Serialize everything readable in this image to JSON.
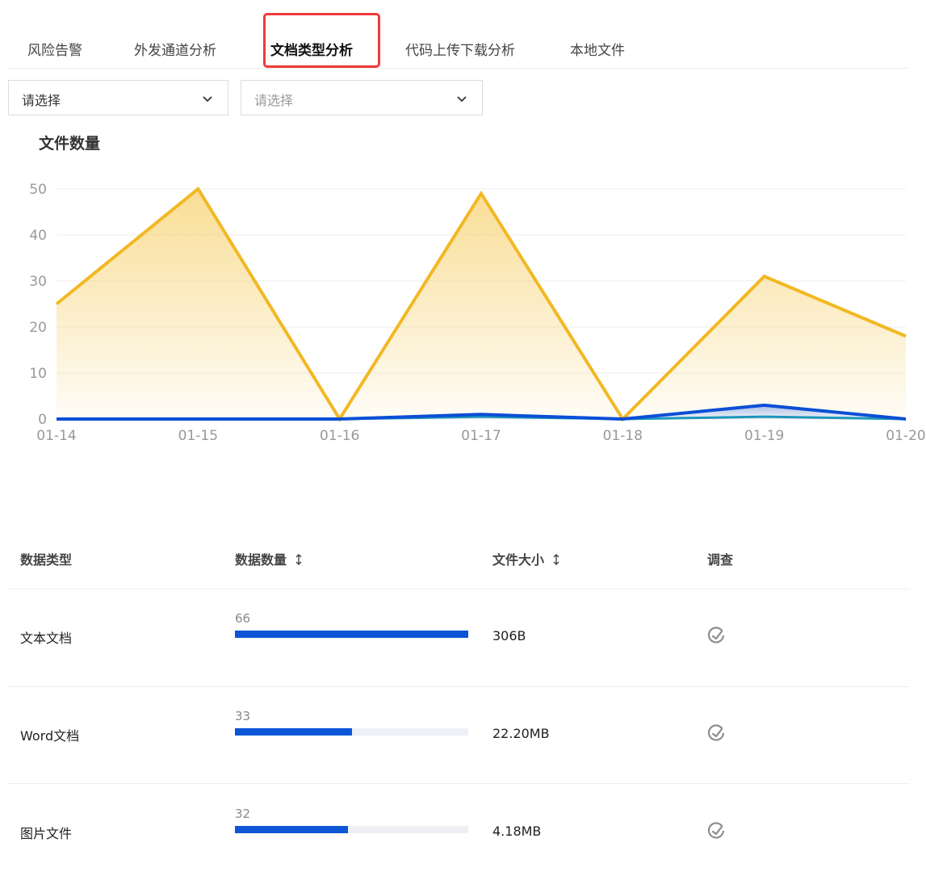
{
  "tabs": [
    {
      "label": "风险告警",
      "active": false
    },
    {
      "label": "外发通道分析",
      "active": false
    },
    {
      "label": "文档类型分析",
      "active": true
    },
    {
      "label": "代码上传下载分析",
      "active": false
    },
    {
      "label": "本地文件",
      "active": false
    }
  ],
  "filters": {
    "select1": {
      "value": "请选择"
    },
    "select2": {
      "placeholder": "请选择"
    }
  },
  "chart_title": "文件数量",
  "chart_data": {
    "type": "area",
    "title": "文件数量",
    "xlabel": "",
    "ylabel": "",
    "categories": [
      "01-14",
      "01-15",
      "01-16",
      "01-17",
      "01-18",
      "01-19",
      "01-20"
    ],
    "ylim": [
      0,
      50
    ],
    "yticks": [
      0,
      10,
      20,
      30,
      40,
      50
    ],
    "grid": true,
    "series": [
      {
        "values": [
          25,
          50,
          0,
          49,
          0,
          31,
          18
        ],
        "color": "#f2b823"
      },
      {
        "values": [
          0,
          0,
          0,
          1,
          0,
          3,
          0
        ],
        "color": "#0b4fd6"
      },
      {
        "values": [
          0,
          0,
          0,
          0.5,
          0,
          0.5,
          0
        ],
        "color": "#1a9ab8"
      }
    ]
  },
  "table": {
    "headers": {
      "type": "数据类型",
      "count": "数据数量",
      "size": "文件大小",
      "investigate": "调查"
    },
    "max_count": 66,
    "rows": [
      {
        "type": "文本文档",
        "count": 66,
        "count_label": "66",
        "size": "306B"
      },
      {
        "type": "Word文档",
        "count": 33,
        "count_label": "33",
        "size": "22.20MB"
      },
      {
        "type": "图片文件",
        "count": 32,
        "count_label": "32",
        "size": "4.18MB"
      }
    ]
  },
  "colors": {
    "accent": "#0b55d6",
    "highlight": "#f03a3a",
    "area": "#f2b823"
  }
}
